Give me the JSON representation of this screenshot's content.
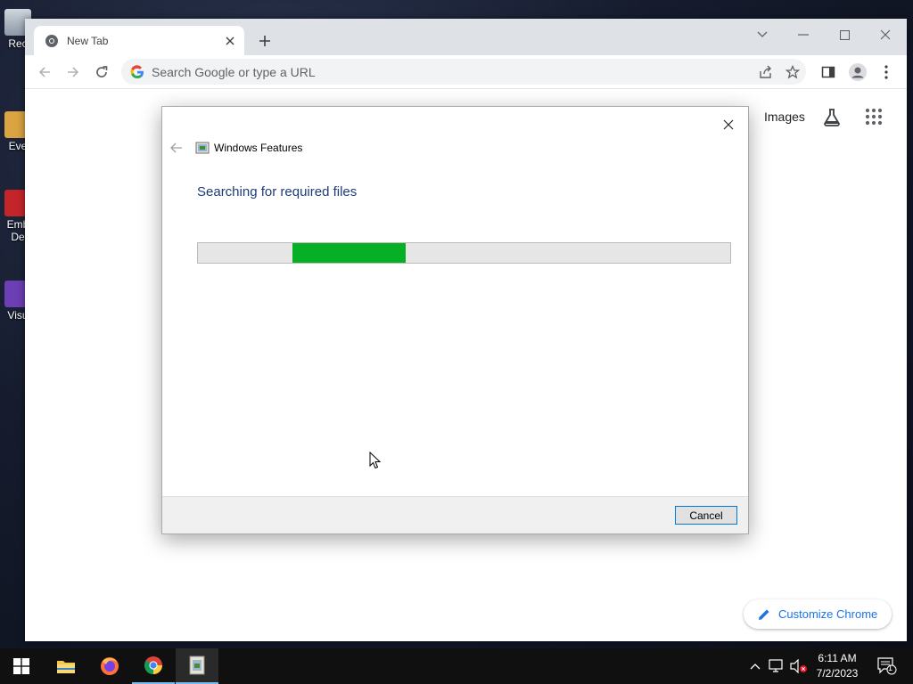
{
  "desktop": {
    "icons": [
      {
        "label": "Rec"
      },
      {
        "label": "Eve"
      },
      {
        "label": "Emb"
      },
      {
        "label": "De"
      },
      {
        "label": "Visu"
      }
    ]
  },
  "browser": {
    "tab_title": "New Tab",
    "omnibox_placeholder": "Search Google or type a URL",
    "ntp": {
      "images_link": "Images",
      "customize_label": "Customize Chrome"
    }
  },
  "dialog": {
    "title": "Windows Features",
    "heading": "Searching for required files",
    "progress": {
      "start_fraction": 0.178,
      "end_fraction": 0.39
    },
    "cancel_label": "Cancel"
  },
  "taskbar": {
    "apps": [
      "start-icon",
      "file-explorer-icon",
      "firefox-icon",
      "chrome-icon",
      "windows-features-icon"
    ],
    "time": "6:11 AM",
    "date": "7/2/2023",
    "notification_count": "1"
  },
  "colors": {
    "progress_fill": "#06b025",
    "heading": "#1e3c78",
    "link_blue": "#1a73e8"
  }
}
